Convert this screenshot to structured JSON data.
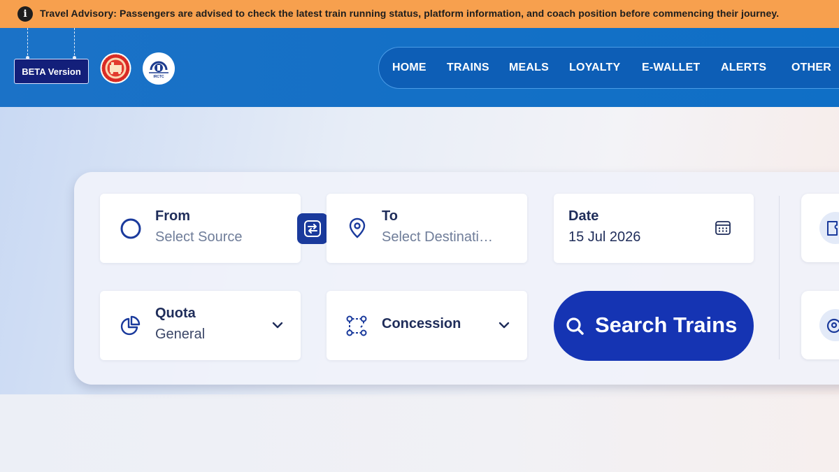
{
  "advisory": {
    "icon": "info-icon",
    "text": "Travel Advisory: Passengers are advised to check the latest train running status, platform information, and coach position before commencing their journey."
  },
  "header": {
    "beta_label": "BETA Version",
    "logos": [
      "indian-railways-logo",
      "irctc-logo"
    ],
    "irctc_small": "IRCTC",
    "nav": [
      "HOME",
      "TRAINS",
      "MEALS",
      "LOYALTY",
      "E-WALLET",
      "ALERTS",
      "OTHER"
    ]
  },
  "search": {
    "from": {
      "label": "From",
      "placeholder": "Select Source",
      "icon": "circle-icon"
    },
    "swap_icon": "swap-icon",
    "to": {
      "label": "To",
      "placeholder": "Select Destinati…",
      "icon": "location-pin-icon"
    },
    "date": {
      "label": "Date",
      "value": "15 Jul 2026",
      "icon": "calendar-icon"
    },
    "quota": {
      "label": "Quota",
      "value": "General",
      "icon": "pie-chart-icon"
    },
    "concession": {
      "label": "Concession",
      "icon": "nodes-icon"
    },
    "search_button": "Search Trains"
  },
  "colors": {
    "advisory_bg": "#f7a04e",
    "header_bg": "#1470c6",
    "primary": "#1534b3",
    "text_dark": "#1f2d5a"
  }
}
